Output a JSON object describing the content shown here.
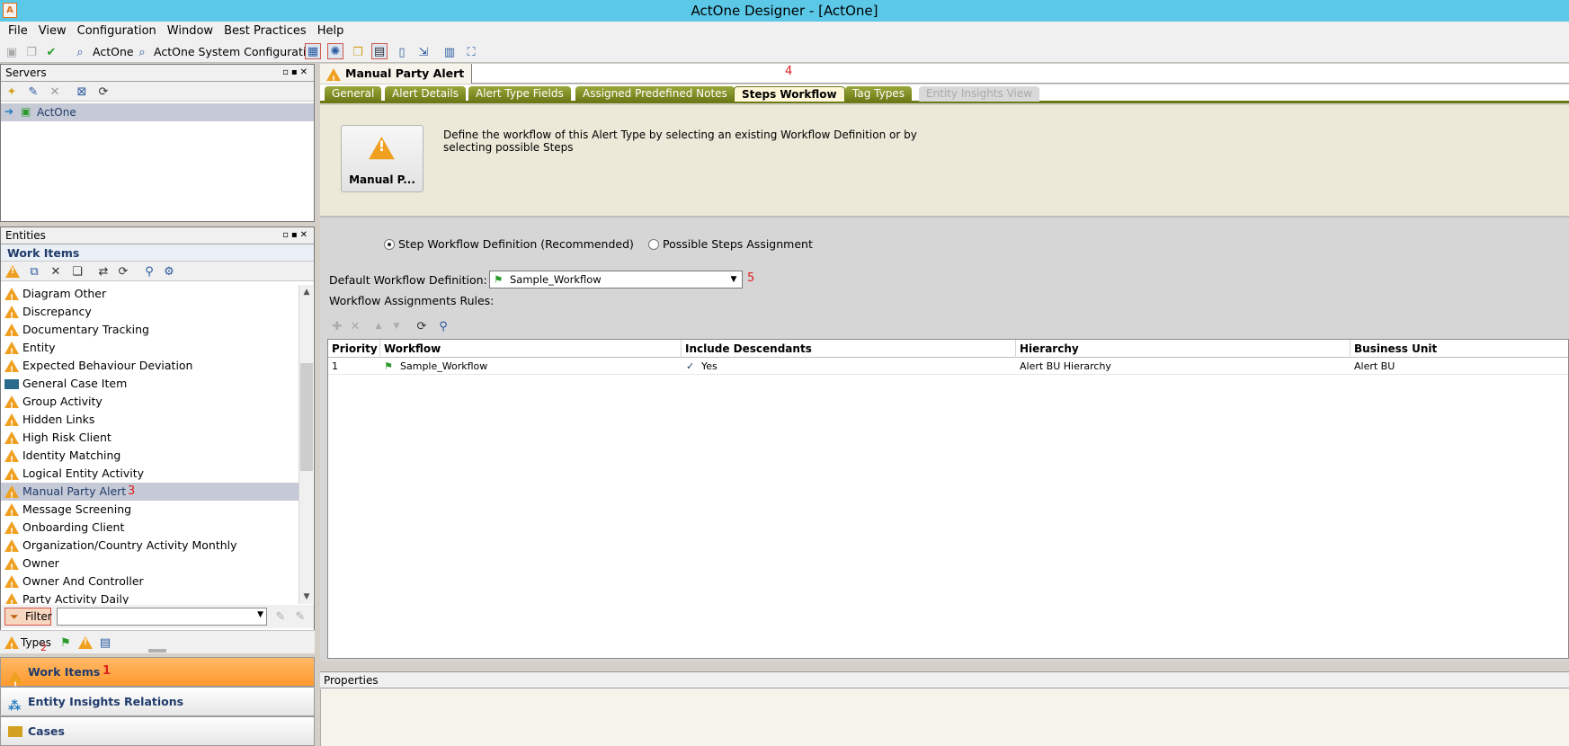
{
  "window": {
    "title": "ActOne Designer - [ActOne]"
  },
  "menu": [
    "File",
    "View",
    "Configuration",
    "Window",
    "Best Practices",
    "Help"
  ],
  "toolbar": {
    "actone_label": "ActOne",
    "system_config_label": "ActOne System Configuration"
  },
  "servers": {
    "title": "Servers",
    "items": [
      {
        "label": "ActOne"
      }
    ]
  },
  "entities": {
    "title": "Entities",
    "subtitle": "Work Items",
    "items": [
      {
        "label": "Diagram Other",
        "icon": "warning-icon"
      },
      {
        "label": "Discrepancy",
        "icon": "warning-icon"
      },
      {
        "label": "Documentary Tracking",
        "icon": "warning-icon"
      },
      {
        "label": "Entity",
        "icon": "warning-icon"
      },
      {
        "label": "Expected Behaviour Deviation",
        "icon": "warning-icon"
      },
      {
        "label": "General Case Item",
        "icon": "folder-icon"
      },
      {
        "label": "Group Activity",
        "icon": "warning-icon"
      },
      {
        "label": "Hidden Links",
        "icon": "warning-icon"
      },
      {
        "label": "High Risk Client",
        "icon": "warning-icon"
      },
      {
        "label": "Identity Matching",
        "icon": "warning-icon"
      },
      {
        "label": "Logical Entity Activity",
        "icon": "warning-icon"
      },
      {
        "label": "Manual Party Alert",
        "icon": "warning-icon",
        "selected": true
      },
      {
        "label": "Message Screening",
        "icon": "warning-icon"
      },
      {
        "label": "Onboarding Client",
        "icon": "warning-icon"
      },
      {
        "label": "Organization/Country Activity Monthly",
        "icon": "warning-icon"
      },
      {
        "label": "Owner",
        "icon": "warning-icon"
      },
      {
        "label": "Owner And Controller",
        "icon": "warning-icon"
      },
      {
        "label": "Party Activity Daily",
        "icon": "warning-icon"
      }
    ],
    "filter_label": "Filter",
    "filter_value": "",
    "types_label": "Types"
  },
  "nav": [
    {
      "label": "Work Items",
      "active": true
    },
    {
      "label": "Entity Insights Relations",
      "active": false
    },
    {
      "label": "Cases",
      "active": false
    }
  ],
  "document": {
    "tab_title": "Manual Party Alert",
    "tabs": [
      {
        "label": "General"
      },
      {
        "label": "Alert Details"
      },
      {
        "label": "Alert Type Fields"
      },
      {
        "label": "Assigned Predefined Notes"
      },
      {
        "label": "Steps Workflow",
        "active": true
      },
      {
        "label": "Tag Types"
      },
      {
        "label": "Entity Insights View",
        "disabled": true
      }
    ],
    "type_card_label": "Manual P...",
    "description": "Define the workflow of this Alert Type by selecting an existing Workflow Definition or by selecting possible Steps",
    "radio_step_workflow": "Step Workflow Definition (Recommended)",
    "radio_possible_steps": "Possible Steps Assignment",
    "default_workflow_label": "Default Workflow Definition:",
    "default_workflow_value": "Sample_Workflow",
    "assignment_rules_label": "Workflow Assignments Rules:",
    "grid": {
      "columns": [
        "Priority",
        "Workflow",
        "Include Descendants",
        "Hierarchy",
        "Business Unit"
      ],
      "rows": [
        {
          "priority": "1",
          "workflow": "Sample_Workflow",
          "include_descendants": "Yes",
          "hierarchy": "Alert BU Hierarchy",
          "business_unit": "Alert BU"
        }
      ]
    }
  },
  "properties": {
    "title": "Properties"
  },
  "annotations": [
    "1",
    "2",
    "3",
    "4",
    "5"
  ],
  "colors": {
    "titlebar": "#5bc8e8",
    "nav_active": "#ff9a2e",
    "tab_green": "#6b7a17",
    "annotation_red": "#e02020"
  }
}
